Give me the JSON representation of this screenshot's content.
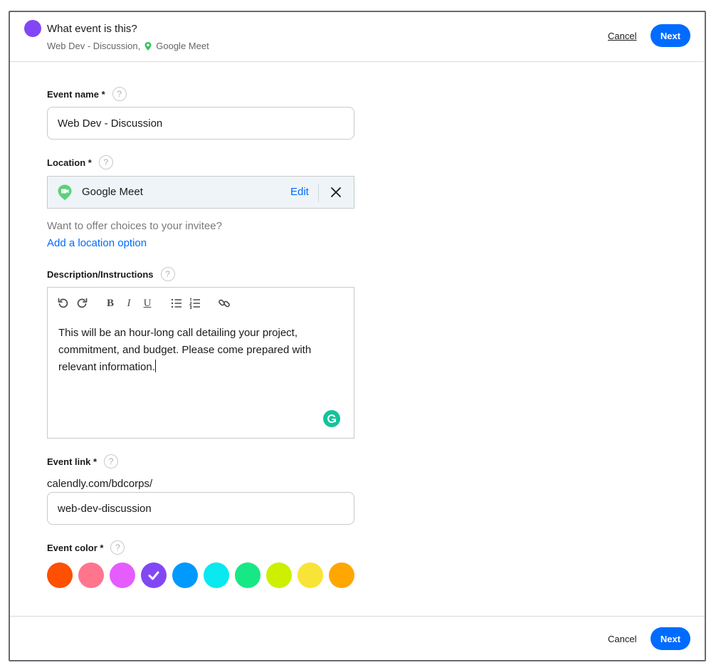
{
  "header": {
    "title": "What event is this?",
    "subtitle_name": "Web Dev - Discussion,",
    "subtitle_location": "Google Meet",
    "cancel_label": "Cancel",
    "next_label": "Next",
    "accent_color": "#8247f5"
  },
  "form": {
    "event_name": {
      "label": "Event name *",
      "value": "Web Dev - Discussion",
      "help": "?"
    },
    "location": {
      "label": "Location *",
      "help": "?",
      "selected": "Google Meet",
      "edit_label": "Edit",
      "hint": "Want to offer choices to your invitee?",
      "add_option_label": "Add a location option"
    },
    "description": {
      "label": "Description/Instructions",
      "help": "?",
      "toolbar": {
        "bold": "B",
        "italic": "I",
        "underline": "U"
      },
      "text": "This will be an hour-long call detailing your project, commitment, and budget. Please come prepared with relevant information."
    },
    "event_link": {
      "label": "Event link *",
      "help": "?",
      "prefix": "calendly.com/bdcorps/",
      "value": "web-dev-discussion"
    },
    "event_color": {
      "label": "Event color *",
      "help": "?",
      "selected_index": 3,
      "colors": [
        "#ff4f00",
        "#ff758e",
        "#e55cff",
        "#8247f5",
        "#0099ff",
        "#0ae8f0",
        "#17e885",
        "#ccf000",
        "#f8e436",
        "#ffa600"
      ]
    }
  },
  "footer": {
    "cancel_label": "Cancel",
    "next_label": "Next"
  },
  "colors": {
    "primary": "#006bff",
    "google_meet": "#34c759",
    "grammarly": "#15c39a"
  }
}
